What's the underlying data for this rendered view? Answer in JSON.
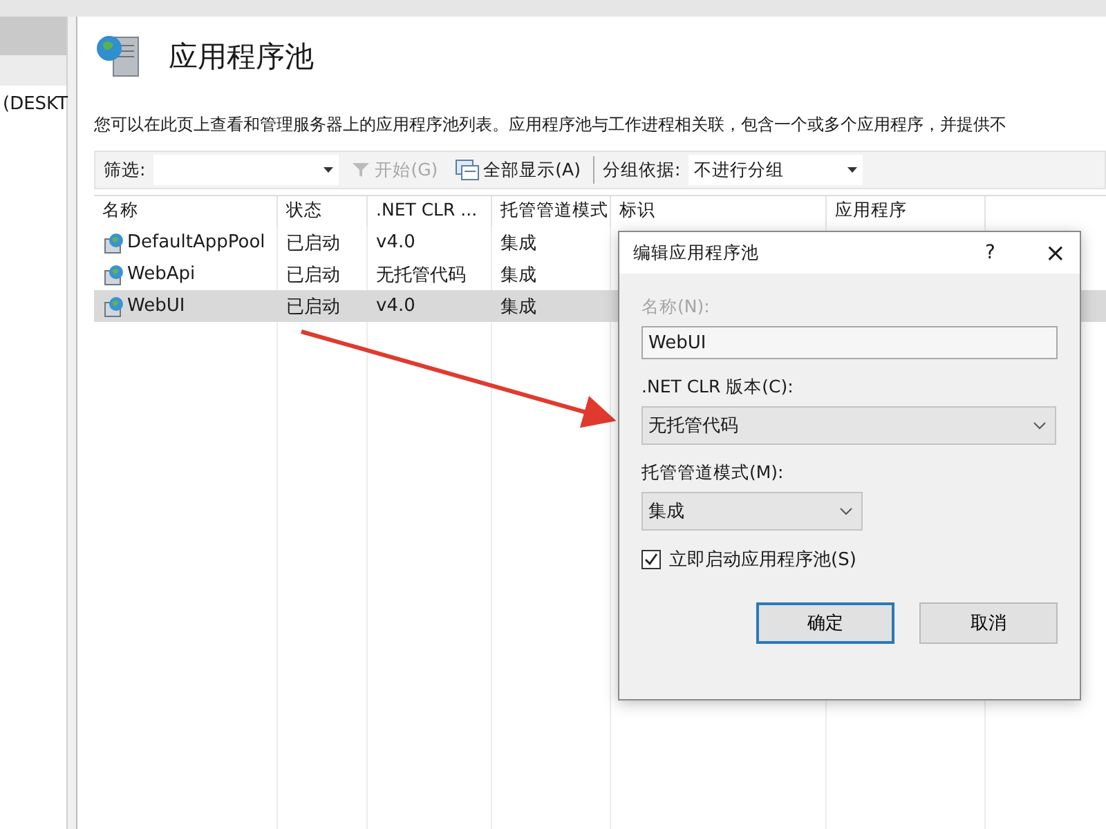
{
  "sidebar": {
    "items": [
      {
        "label": "(DESKT"
      }
    ]
  },
  "page": {
    "title": "应用程序池",
    "description": "您可以在此页上查看和管理服务器上的应用程序池列表。应用程序池与工作进程相关联，包含一个或多个应用程序，并提供不"
  },
  "toolbar": {
    "filter_label": "筛选:",
    "start_label": "开始(G)",
    "start_disabled": true,
    "show_all_label": "全部显示(A)",
    "group_label": "分组依据:",
    "group_value": "不进行分组"
  },
  "table": {
    "columns": [
      "名称",
      "状态",
      ".NET CLR ...",
      "托管管道模式",
      "标识",
      "应用程序"
    ],
    "rows": [
      {
        "cells": [
          "DefaultAppPool",
          "已启动",
          "v4.0",
          "集成"
        ],
        "selected": false
      },
      {
        "cells": [
          "WebApi",
          "已启动",
          "无托管代码",
          "集成"
        ],
        "selected": false
      },
      {
        "cells": [
          "WebUI",
          "已启动",
          "v4.0",
          "集成"
        ],
        "selected": true
      }
    ]
  },
  "dialog": {
    "title": "编辑应用程序池",
    "help": "?",
    "close": "×",
    "name_label": "名称(N):",
    "name_label_disabled": true,
    "name_value": "WebUI",
    "clr_label": ".NET CLR 版本(C):",
    "clr_value": "无托管代码",
    "pipeline_label": "托管管道模式(M):",
    "pipeline_value": "集成",
    "start_checkbox": {
      "label": "立即启动应用程序池(S)",
      "checked": true
    },
    "buttons": [
      "确定",
      "取消"
    ]
  }
}
